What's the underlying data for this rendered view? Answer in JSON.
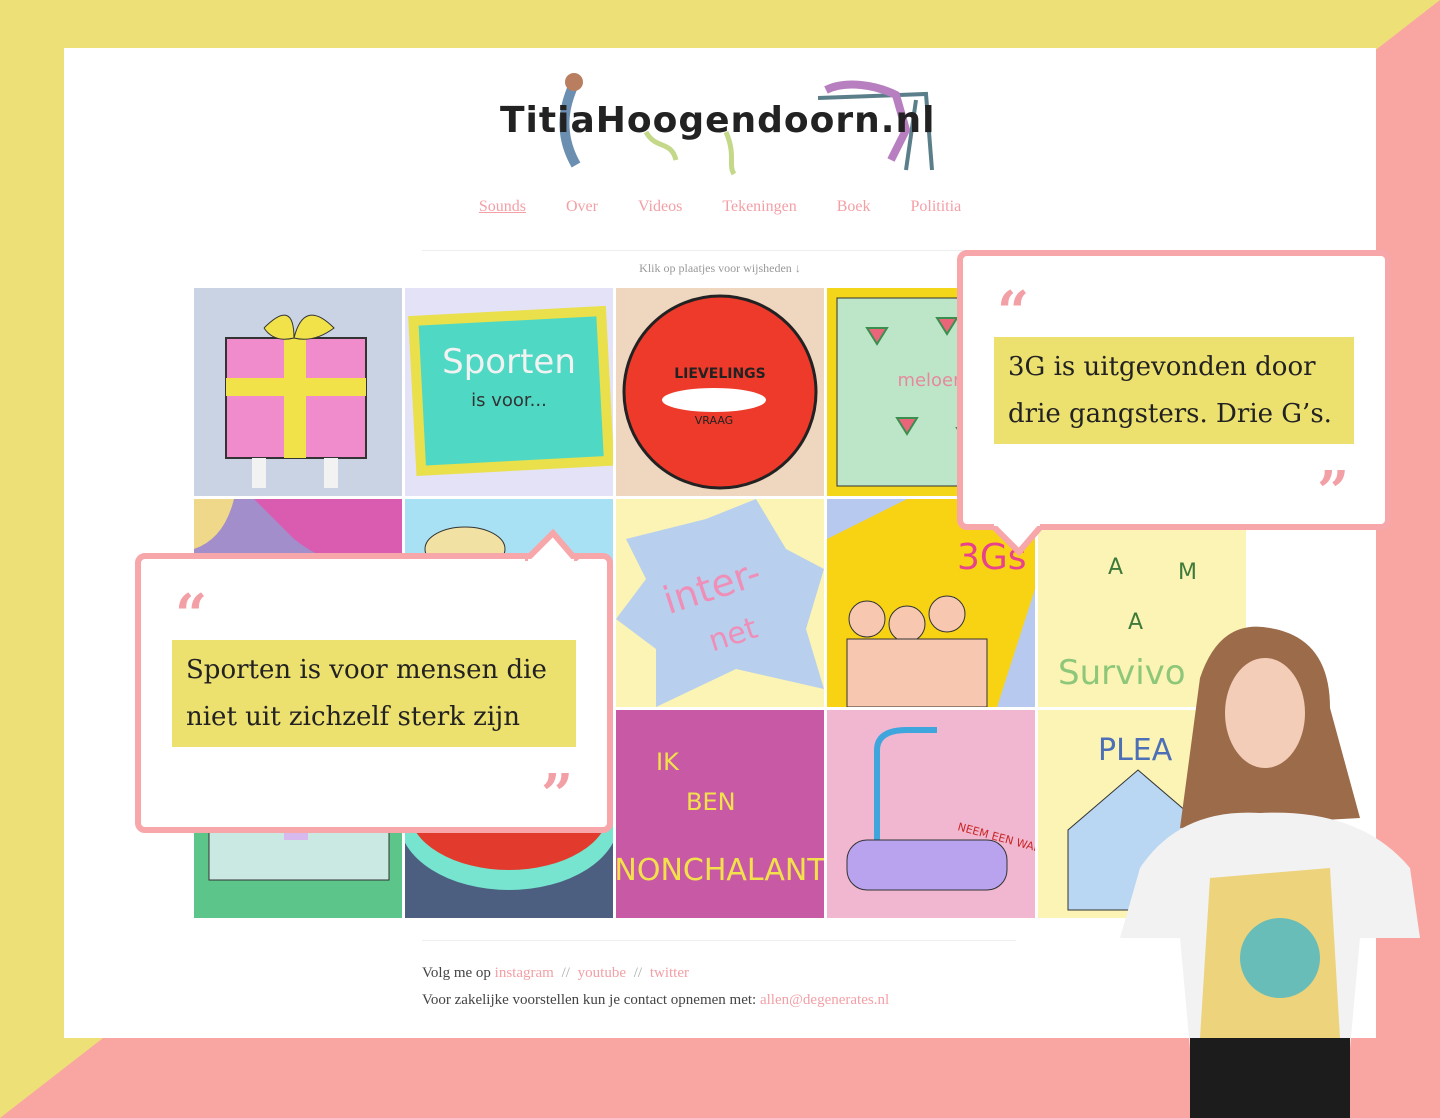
{
  "site": {
    "logo_text": "TitiaHoogendoorn.nl"
  },
  "nav": {
    "items": [
      {
        "label": "Sounds",
        "active": true
      },
      {
        "label": "Over",
        "active": false
      },
      {
        "label": "Videos",
        "active": false
      },
      {
        "label": "Tekeningen",
        "active": false
      },
      {
        "label": "Boek",
        "active": false
      },
      {
        "label": "Polititia",
        "active": false
      }
    ]
  },
  "hint": {
    "text": "Klik op plaatjes voor wijsheden",
    "arrow_icon": "arrow-down-icon"
  },
  "tiles": [
    {
      "name": "tile-gift",
      "text": ""
    },
    {
      "name": "tile-sporten",
      "text": "Sporten is voor..."
    },
    {
      "name": "tile-lievelings",
      "text": "Lievelings Vraag"
    },
    {
      "name": "tile-meloen",
      "text": "meloen"
    },
    {
      "name": "tile-internet",
      "text": "inter-net"
    },
    {
      "name": "tile-3gs",
      "text": "3Gs"
    },
    {
      "name": "tile-survivor",
      "text": "A M A Survivo"
    },
    {
      "name": "tile-nonchalant",
      "text": "ik ben nonchalant"
    },
    {
      "name": "tile-bath",
      "text": "Neem een warm bad"
    },
    {
      "name": "tile-please",
      "text": "PLEA"
    }
  ],
  "footer": {
    "follow_prefix": "Volg me op",
    "links": [
      "instagram",
      "youtube",
      "twitter"
    ],
    "separator": "//",
    "contact_prefix": "Voor zakelijke voorstellen kun je contact opnemen met:",
    "email": "allen@degenerates.nl"
  },
  "quotes": [
    {
      "open": "“",
      "text_line1": "3G is uitgevonden door",
      "text_line2": "drie gangsters.  Drie G’s.",
      "close": "”"
    },
    {
      "open": "“",
      "text_line1": "Sporten is voor mensen die",
      "text_line2": "niet uit zichzelf sterk zijn",
      "close": "”"
    }
  ],
  "colors": {
    "pink": "#f9a6a3",
    "yellow": "#ece06f",
    "link": "#f39fa6"
  }
}
